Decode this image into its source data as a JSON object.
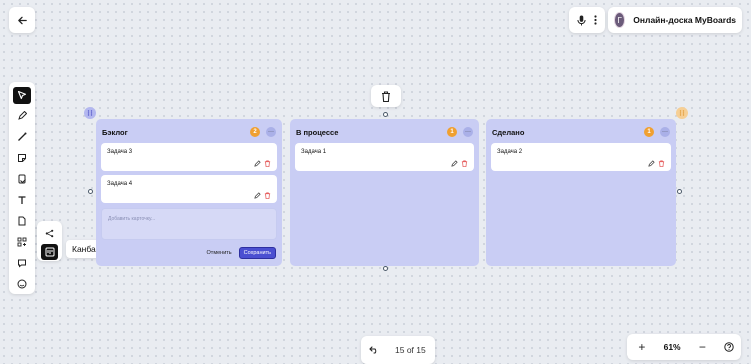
{
  "header": {
    "board_title": "Онлайн-доска MyBoards",
    "avatar_letter": "Г"
  },
  "sidebar": {
    "tools": [
      "select-icon",
      "pen-icon",
      "line-icon",
      "sticker-icon",
      "template-icon",
      "text-icon",
      "document-icon",
      "apps-icon",
      "comment-icon",
      "emoji-icon"
    ],
    "active": "select-icon"
  },
  "subtools": {
    "items": [
      "mindmap-icon",
      "kanban-icon"
    ],
    "active": "kanban-icon",
    "tooltip": "Канбан"
  },
  "kanban": {
    "columns": [
      {
        "title": "Бэклог",
        "count": "2",
        "cards": [
          "Задача 3",
          "Задача 4"
        ]
      },
      {
        "title": "В процессе",
        "count": "1",
        "cards": [
          "Задача 1"
        ]
      },
      {
        "title": "Сделано",
        "count": "1",
        "cards": [
          "Задача 2"
        ]
      }
    ],
    "new_card": {
      "placeholder": "Добавить карточку...",
      "cancel_label": "Отменить",
      "save_label": "Сохранить"
    },
    "more_glyph": "···"
  },
  "footer": {
    "pages": "15 of 15",
    "zoom": "61%",
    "zoom_in": "+",
    "zoom_out": "−"
  },
  "colors": {
    "column_bg": "#c9cdf4",
    "count_badge": "#f0a030",
    "save_button": "#4b4fd1",
    "delete_icon": "#e24a4a",
    "canvas": "#e9ecf1"
  }
}
